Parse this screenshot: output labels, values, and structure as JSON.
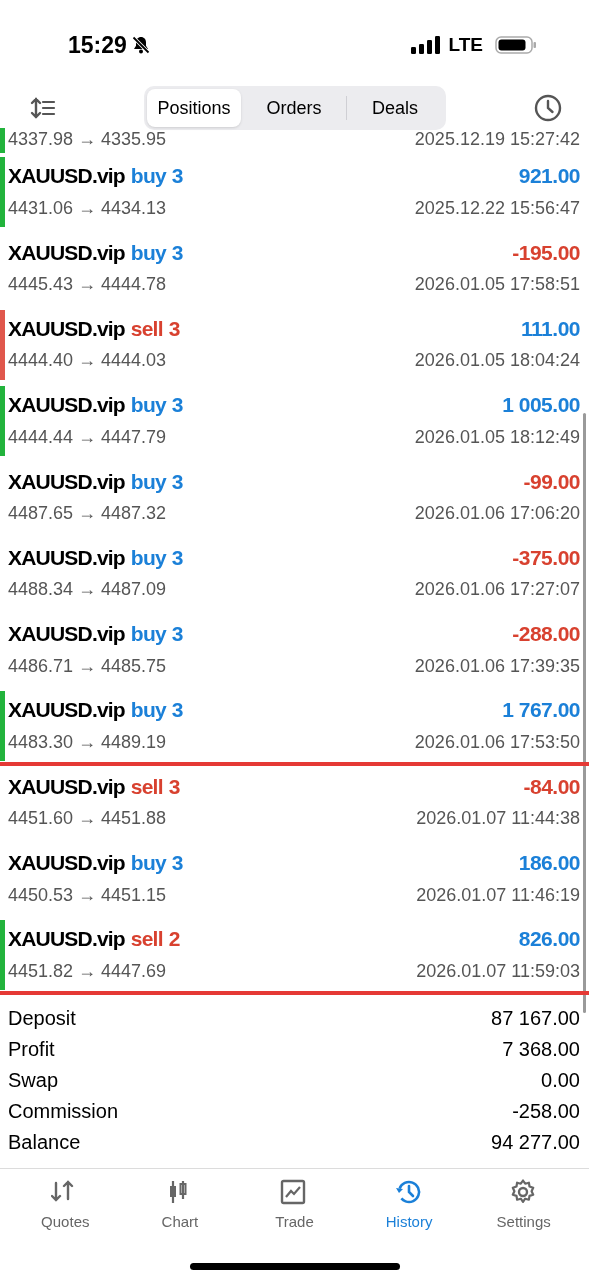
{
  "status_bar": {
    "time": "15:29",
    "network": "LTE"
  },
  "segments": [
    {
      "label": "Positions",
      "selected": true
    },
    {
      "label": "Orders",
      "selected": false
    },
    {
      "label": "Deals",
      "selected": false
    }
  ],
  "partial_row": {
    "prices": "4337.98 → 4335.95",
    "time": "2025.12.19 15:27:42",
    "side_bar": {
      "color": "#22b33c"
    }
  },
  "deals": [
    {
      "symbol": "XAUUSD.vip",
      "side": {
        "text": "buy",
        "color": "#1b80d8"
      },
      "volume": "3",
      "profit": {
        "text": "921.00",
        "color": "#1b80d8"
      },
      "prices": "4431.06 → 4434.13",
      "time": "2025.12.22 15:56:47",
      "side_bar": {
        "color": "#22b33c"
      },
      "underlined": false
    },
    {
      "symbol": "XAUUSD.vip",
      "side": {
        "text": "buy",
        "color": "#1b80d8"
      },
      "volume": "3",
      "profit": {
        "text": "-195.00",
        "color": "#d8412f"
      },
      "prices": "4445.43 → 4444.78",
      "time": "2026.01.05 17:58:51",
      "underlined": false
    },
    {
      "symbol": "XAUUSD.vip",
      "side": {
        "text": "sell",
        "color": "#d8412f"
      },
      "volume": "3",
      "profit": {
        "text": "111.00",
        "color": "#1b80d8"
      },
      "prices": "4444.40 → 4444.03",
      "time": "2026.01.05 18:04:24",
      "side_bar": {
        "color": "#e0574c"
      },
      "underlined": false
    },
    {
      "symbol": "XAUUSD.vip",
      "side": {
        "text": "buy",
        "color": "#1b80d8"
      },
      "volume": "3",
      "profit": {
        "text": "1 005.00",
        "color": "#1b80d8"
      },
      "prices": "4444.44 → 4447.79",
      "time": "2026.01.05 18:12:49",
      "side_bar": {
        "color": "#22b33c"
      },
      "underlined": false
    },
    {
      "symbol": "XAUUSD.vip",
      "side": {
        "text": "buy",
        "color": "#1b80d8"
      },
      "volume": "3",
      "profit": {
        "text": "-99.00",
        "color": "#d8412f"
      },
      "prices": "4487.65 → 4487.32",
      "time": "2026.01.06 17:06:20",
      "underlined": false
    },
    {
      "symbol": "XAUUSD.vip",
      "side": {
        "text": "buy",
        "color": "#1b80d8"
      },
      "volume": "3",
      "profit": {
        "text": "-375.00",
        "color": "#d8412f"
      },
      "prices": "4488.34 → 4487.09",
      "time": "2026.01.06 17:27:07",
      "underlined": false
    },
    {
      "symbol": "XAUUSD.vip",
      "side": {
        "text": "buy",
        "color": "#1b80d8"
      },
      "volume": "3",
      "profit": {
        "text": "-288.00",
        "color": "#d8412f"
      },
      "prices": "4486.71 → 4485.75",
      "time": "2026.01.06 17:39:35",
      "underlined": false
    },
    {
      "symbol": "XAUUSD.vip",
      "side": {
        "text": "buy",
        "color": "#1b80d8"
      },
      "volume": "3",
      "profit": {
        "text": "1 767.00",
        "color": "#1b80d8"
      },
      "prices": "4483.30 → 4489.19",
      "time": "2026.01.06 17:53:50",
      "side_bar": {
        "color": "#22b33c"
      },
      "underlined": true
    },
    {
      "symbol": "XAUUSD.vip",
      "side": {
        "text": "sell",
        "color": "#d8412f"
      },
      "volume": "3",
      "profit": {
        "text": "-84.00",
        "color": "#d8412f"
      },
      "prices": "4451.60 → 4451.88",
      "time": "2026.01.07 11:44:38",
      "underlined": false
    },
    {
      "symbol": "XAUUSD.vip",
      "side": {
        "text": "buy",
        "color": "#1b80d8"
      },
      "volume": "3",
      "profit": {
        "text": "186.00",
        "color": "#1b80d8"
      },
      "prices": "4450.53 → 4451.15",
      "time": "2026.01.07 11:46:19",
      "underlined": false
    },
    {
      "symbol": "XAUUSD.vip",
      "side": {
        "text": "sell",
        "color": "#d8412f"
      },
      "volume": "2",
      "profit": {
        "text": "826.00",
        "color": "#1b80d8"
      },
      "prices": "4451.82 → 4447.69",
      "time": "2026.01.07 11:59:03",
      "side_bar": {
        "color": "#22b33c"
      },
      "underlined": true
    }
  ],
  "summary": [
    {
      "label": "Deposit",
      "value": "87 167.00"
    },
    {
      "label": "Profit",
      "value": "7 368.00"
    },
    {
      "label": "Swap",
      "value": "0.00"
    },
    {
      "label": "Commission",
      "value": "-258.00"
    },
    {
      "label": "Balance",
      "value": "94 277.00"
    }
  ],
  "tab_bar": [
    {
      "label": "Quotes",
      "selected": false
    },
    {
      "label": "Chart",
      "selected": false
    },
    {
      "label": "Trade",
      "selected": false
    },
    {
      "label": "History",
      "selected": true
    },
    {
      "label": "Settings",
      "selected": false
    }
  ]
}
